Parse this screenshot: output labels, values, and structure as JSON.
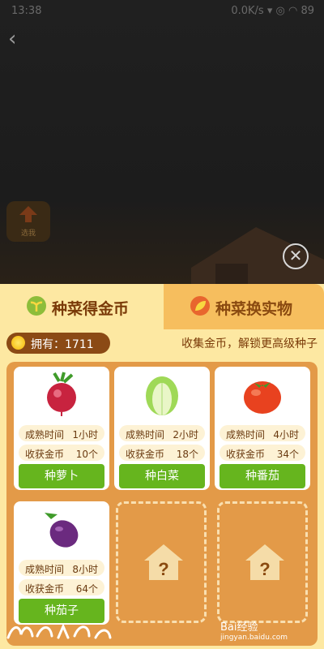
{
  "status": {
    "time": "13:38",
    "network": "0.0K/s",
    "battery": "89"
  },
  "scene": {
    "badge_text": "选我"
  },
  "tabs": [
    {
      "label": "种菜得金币"
    },
    {
      "label": "种菜换实物"
    }
  ],
  "coins": {
    "label": "拥有：1711"
  },
  "hint": "收集金币，解锁更高级种子",
  "labels": {
    "time": "成熟时间",
    "gold": "收获金币"
  },
  "veggies": [
    {
      "time": "1小时",
      "gold": "10个",
      "button": "种萝卜",
      "icon": "radish-icon"
    },
    {
      "time": "2小时",
      "gold": "18个",
      "button": "种白菜",
      "icon": "cabbage-icon"
    },
    {
      "time": "4小时",
      "gold": "34个",
      "button": "种番茄",
      "icon": "tomato-icon"
    },
    {
      "time": "8小时",
      "gold": "64个",
      "button": "种茄子",
      "icon": "eggplant-icon"
    }
  ],
  "locked": [
    {
      "symbol": "?"
    },
    {
      "symbol": "?"
    }
  ],
  "watermark": "Bai经验",
  "watermark_sub": "jingyan.baidu.com"
}
